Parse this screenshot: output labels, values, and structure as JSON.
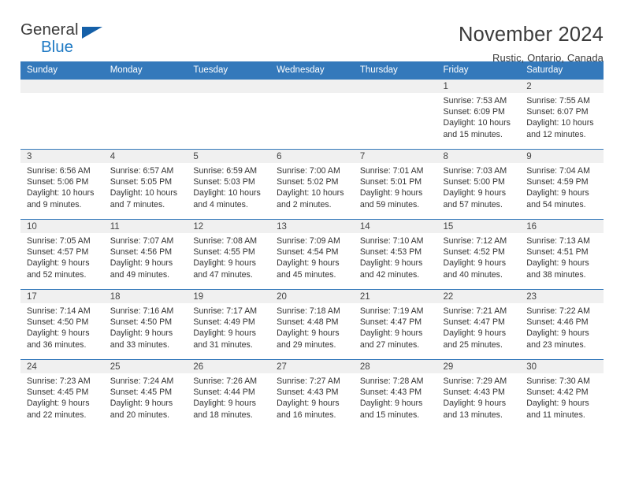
{
  "brand": {
    "name_part1": "General",
    "name_part2": "Blue"
  },
  "header": {
    "title": "November 2024",
    "subtitle": "Rustic, Ontario, Canada"
  },
  "colors": {
    "header_blue": "#3479bb",
    "logo_blue": "#1f7ac4",
    "daynum_bg": "#f0f0f0"
  },
  "weekdays": [
    "Sunday",
    "Monday",
    "Tuesday",
    "Wednesday",
    "Thursday",
    "Friday",
    "Saturday"
  ],
  "weeks": [
    [
      {
        "empty": true
      },
      {
        "empty": true
      },
      {
        "empty": true
      },
      {
        "empty": true
      },
      {
        "empty": true
      },
      {
        "day": "1",
        "sunrise": "Sunrise: 7:53 AM",
        "sunset": "Sunset: 6:09 PM",
        "daylight1": "Daylight: 10 hours",
        "daylight2": "and 15 minutes."
      },
      {
        "day": "2",
        "sunrise": "Sunrise: 7:55 AM",
        "sunset": "Sunset: 6:07 PM",
        "daylight1": "Daylight: 10 hours",
        "daylight2": "and 12 minutes."
      }
    ],
    [
      {
        "day": "3",
        "sunrise": "Sunrise: 6:56 AM",
        "sunset": "Sunset: 5:06 PM",
        "daylight1": "Daylight: 10 hours",
        "daylight2": "and 9 minutes."
      },
      {
        "day": "4",
        "sunrise": "Sunrise: 6:57 AM",
        "sunset": "Sunset: 5:05 PM",
        "daylight1": "Daylight: 10 hours",
        "daylight2": "and 7 minutes."
      },
      {
        "day": "5",
        "sunrise": "Sunrise: 6:59 AM",
        "sunset": "Sunset: 5:03 PM",
        "daylight1": "Daylight: 10 hours",
        "daylight2": "and 4 minutes."
      },
      {
        "day": "6",
        "sunrise": "Sunrise: 7:00 AM",
        "sunset": "Sunset: 5:02 PM",
        "daylight1": "Daylight: 10 hours",
        "daylight2": "and 2 minutes."
      },
      {
        "day": "7",
        "sunrise": "Sunrise: 7:01 AM",
        "sunset": "Sunset: 5:01 PM",
        "daylight1": "Daylight: 9 hours",
        "daylight2": "and 59 minutes."
      },
      {
        "day": "8",
        "sunrise": "Sunrise: 7:03 AM",
        "sunset": "Sunset: 5:00 PM",
        "daylight1": "Daylight: 9 hours",
        "daylight2": "and 57 minutes."
      },
      {
        "day": "9",
        "sunrise": "Sunrise: 7:04 AM",
        "sunset": "Sunset: 4:59 PM",
        "daylight1": "Daylight: 9 hours",
        "daylight2": "and 54 minutes."
      }
    ],
    [
      {
        "day": "10",
        "sunrise": "Sunrise: 7:05 AM",
        "sunset": "Sunset: 4:57 PM",
        "daylight1": "Daylight: 9 hours",
        "daylight2": "and 52 minutes."
      },
      {
        "day": "11",
        "sunrise": "Sunrise: 7:07 AM",
        "sunset": "Sunset: 4:56 PM",
        "daylight1": "Daylight: 9 hours",
        "daylight2": "and 49 minutes."
      },
      {
        "day": "12",
        "sunrise": "Sunrise: 7:08 AM",
        "sunset": "Sunset: 4:55 PM",
        "daylight1": "Daylight: 9 hours",
        "daylight2": "and 47 minutes."
      },
      {
        "day": "13",
        "sunrise": "Sunrise: 7:09 AM",
        "sunset": "Sunset: 4:54 PM",
        "daylight1": "Daylight: 9 hours",
        "daylight2": "and 45 minutes."
      },
      {
        "day": "14",
        "sunrise": "Sunrise: 7:10 AM",
        "sunset": "Sunset: 4:53 PM",
        "daylight1": "Daylight: 9 hours",
        "daylight2": "and 42 minutes."
      },
      {
        "day": "15",
        "sunrise": "Sunrise: 7:12 AM",
        "sunset": "Sunset: 4:52 PM",
        "daylight1": "Daylight: 9 hours",
        "daylight2": "and 40 minutes."
      },
      {
        "day": "16",
        "sunrise": "Sunrise: 7:13 AM",
        "sunset": "Sunset: 4:51 PM",
        "daylight1": "Daylight: 9 hours",
        "daylight2": "and 38 minutes."
      }
    ],
    [
      {
        "day": "17",
        "sunrise": "Sunrise: 7:14 AM",
        "sunset": "Sunset: 4:50 PM",
        "daylight1": "Daylight: 9 hours",
        "daylight2": "and 36 minutes."
      },
      {
        "day": "18",
        "sunrise": "Sunrise: 7:16 AM",
        "sunset": "Sunset: 4:50 PM",
        "daylight1": "Daylight: 9 hours",
        "daylight2": "and 33 minutes."
      },
      {
        "day": "19",
        "sunrise": "Sunrise: 7:17 AM",
        "sunset": "Sunset: 4:49 PM",
        "daylight1": "Daylight: 9 hours",
        "daylight2": "and 31 minutes."
      },
      {
        "day": "20",
        "sunrise": "Sunrise: 7:18 AM",
        "sunset": "Sunset: 4:48 PM",
        "daylight1": "Daylight: 9 hours",
        "daylight2": "and 29 minutes."
      },
      {
        "day": "21",
        "sunrise": "Sunrise: 7:19 AM",
        "sunset": "Sunset: 4:47 PM",
        "daylight1": "Daylight: 9 hours",
        "daylight2": "and 27 minutes."
      },
      {
        "day": "22",
        "sunrise": "Sunrise: 7:21 AM",
        "sunset": "Sunset: 4:47 PM",
        "daylight1": "Daylight: 9 hours",
        "daylight2": "and 25 minutes."
      },
      {
        "day": "23",
        "sunrise": "Sunrise: 7:22 AM",
        "sunset": "Sunset: 4:46 PM",
        "daylight1": "Daylight: 9 hours",
        "daylight2": "and 23 minutes."
      }
    ],
    [
      {
        "day": "24",
        "sunrise": "Sunrise: 7:23 AM",
        "sunset": "Sunset: 4:45 PM",
        "daylight1": "Daylight: 9 hours",
        "daylight2": "and 22 minutes."
      },
      {
        "day": "25",
        "sunrise": "Sunrise: 7:24 AM",
        "sunset": "Sunset: 4:45 PM",
        "daylight1": "Daylight: 9 hours",
        "daylight2": "and 20 minutes."
      },
      {
        "day": "26",
        "sunrise": "Sunrise: 7:26 AM",
        "sunset": "Sunset: 4:44 PM",
        "daylight1": "Daylight: 9 hours",
        "daylight2": "and 18 minutes."
      },
      {
        "day": "27",
        "sunrise": "Sunrise: 7:27 AM",
        "sunset": "Sunset: 4:43 PM",
        "daylight1": "Daylight: 9 hours",
        "daylight2": "and 16 minutes."
      },
      {
        "day": "28",
        "sunrise": "Sunrise: 7:28 AM",
        "sunset": "Sunset: 4:43 PM",
        "daylight1": "Daylight: 9 hours",
        "daylight2": "and 15 minutes."
      },
      {
        "day": "29",
        "sunrise": "Sunrise: 7:29 AM",
        "sunset": "Sunset: 4:43 PM",
        "daylight1": "Daylight: 9 hours",
        "daylight2": "and 13 minutes."
      },
      {
        "day": "30",
        "sunrise": "Sunrise: 7:30 AM",
        "sunset": "Sunset: 4:42 PM",
        "daylight1": "Daylight: 9 hours",
        "daylight2": "and 11 minutes."
      }
    ]
  ]
}
